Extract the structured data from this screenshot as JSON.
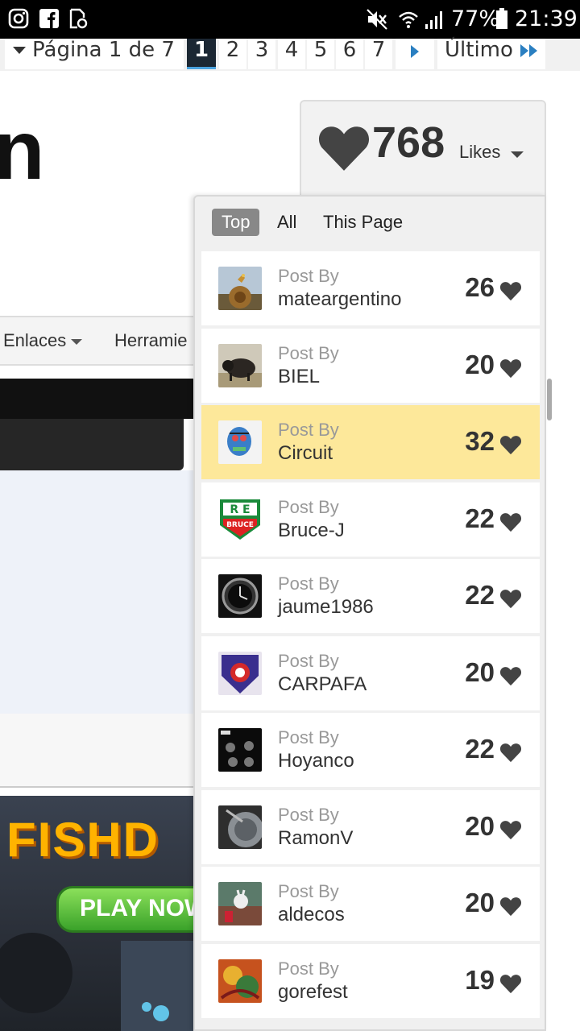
{
  "status_bar": {
    "battery": "77%",
    "time": "21:39",
    "icons": [
      "instagram-icon",
      "facebook-icon",
      "notification-file-icon",
      "mute-icon",
      "wifi-icon",
      "signal-icon",
      "battery-icon"
    ]
  },
  "pager": {
    "label": "Página 1 de 7",
    "pages": [
      "1",
      "2",
      "3",
      "4",
      "5",
      "6",
      "7"
    ],
    "current": "1",
    "last_label": "Último"
  },
  "page": {
    "title_fragment": "n",
    "nav": [
      "Enlaces",
      "Herramie"
    ]
  },
  "ad": {
    "title": "FISHD",
    "button": "PLAY NOW"
  },
  "likes": {
    "count": "768",
    "label": "Likes",
    "tabs": [
      "Top",
      "All",
      "This Page"
    ],
    "active_tab": "Top",
    "posts": [
      {
        "post_by": "Post By",
        "user": "mateargentino",
        "count": "26"
      },
      {
        "post_by": "Post By",
        "user": "BIEL",
        "count": "20"
      },
      {
        "post_by": "Post By",
        "user": "Circuit",
        "count": "32",
        "highlighted": true
      },
      {
        "post_by": "Post By",
        "user": "Bruce-J",
        "count": "22"
      },
      {
        "post_by": "Post By",
        "user": "jaume1986",
        "count": "22"
      },
      {
        "post_by": "Post By",
        "user": "CARPAFA",
        "count": "20"
      },
      {
        "post_by": "Post By",
        "user": "Hoyanco",
        "count": "22"
      },
      {
        "post_by": "Post By",
        "user": "RamonV",
        "count": "20"
      },
      {
        "post_by": "Post By",
        "user": "aldecos",
        "count": "20"
      },
      {
        "post_by": "Post By",
        "user": "gorefest",
        "count": "19"
      }
    ]
  },
  "colors": {
    "highlight": "#fde89a",
    "heart": "#444444",
    "active_tab": "#888888"
  }
}
